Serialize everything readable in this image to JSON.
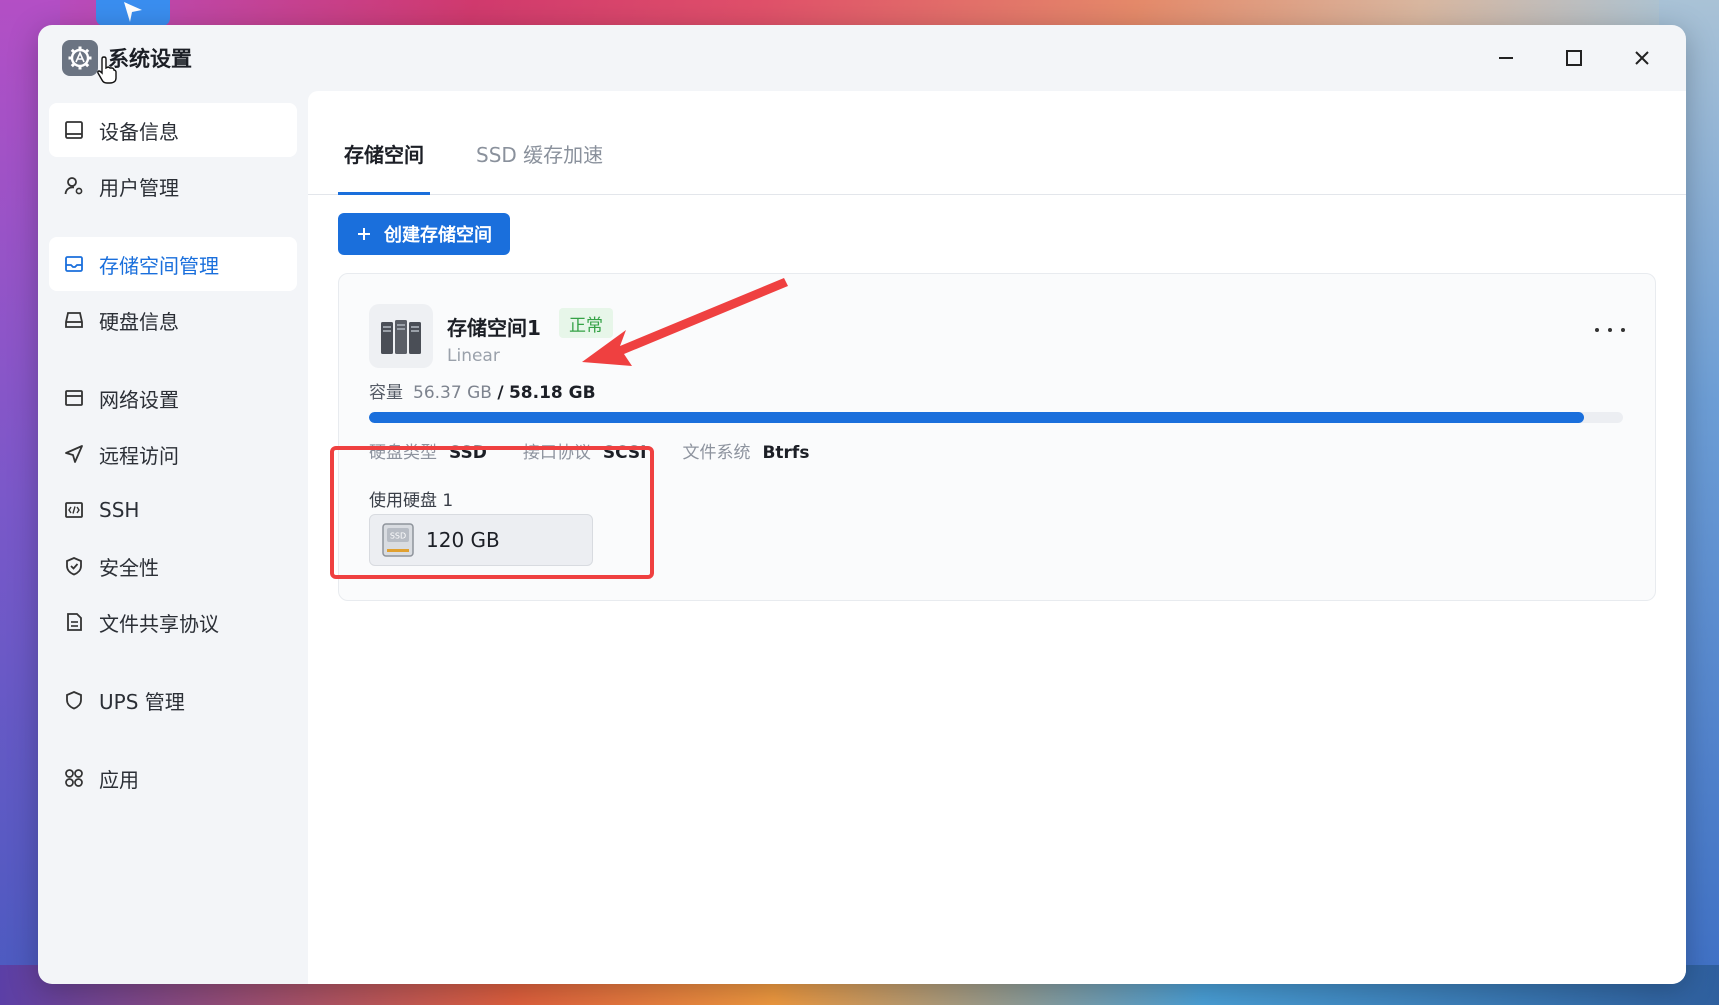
{
  "window": {
    "title": "系统设置"
  },
  "sidebar": {
    "items": [
      {
        "label": "设备信息",
        "icon": "device-icon"
      },
      {
        "label": "用户管理",
        "icon": "user-settings-icon"
      },
      {
        "label": "存储空间管理",
        "icon": "storage-icon",
        "active": true
      },
      {
        "label": "硬盘信息",
        "icon": "hard-disk-icon"
      },
      {
        "label": "网络设置",
        "icon": "network-icon"
      },
      {
        "label": "远程访问",
        "icon": "send-icon"
      },
      {
        "label": "SSH",
        "icon": "code-icon"
      },
      {
        "label": "安全性",
        "icon": "shield-check-icon"
      },
      {
        "label": "文件共享协议",
        "icon": "document-icon"
      },
      {
        "label": "UPS 管理",
        "icon": "shield-icon"
      },
      {
        "label": "应用",
        "icon": "apps-icon"
      }
    ]
  },
  "tabs": [
    {
      "label": "存储空间",
      "active": true
    },
    {
      "label": "SSD 缓存加速",
      "active": false
    }
  ],
  "toolbar": {
    "create_label": "创建存储空间"
  },
  "pool": {
    "name": "存储空间1",
    "status": "正常",
    "type": "Linear",
    "capacity_label": "容量",
    "used": "56.37 GB",
    "separator": "/",
    "total": "58.18 GB",
    "usage_fraction": 0.969,
    "disk_type_label": "硬盘类型",
    "disk_type": "SSD",
    "interface_label": "接口协议",
    "interface": "SCSI",
    "fs_label": "文件系统",
    "fs": "Btrfs",
    "disks_label": "使用硬盘 1",
    "disk_size": "120 GB",
    "disk_icon_text": "SSD"
  },
  "colors": {
    "accent": "#1a6fdc",
    "status_green": "#35a246",
    "annotation_red": "#ef4040"
  }
}
